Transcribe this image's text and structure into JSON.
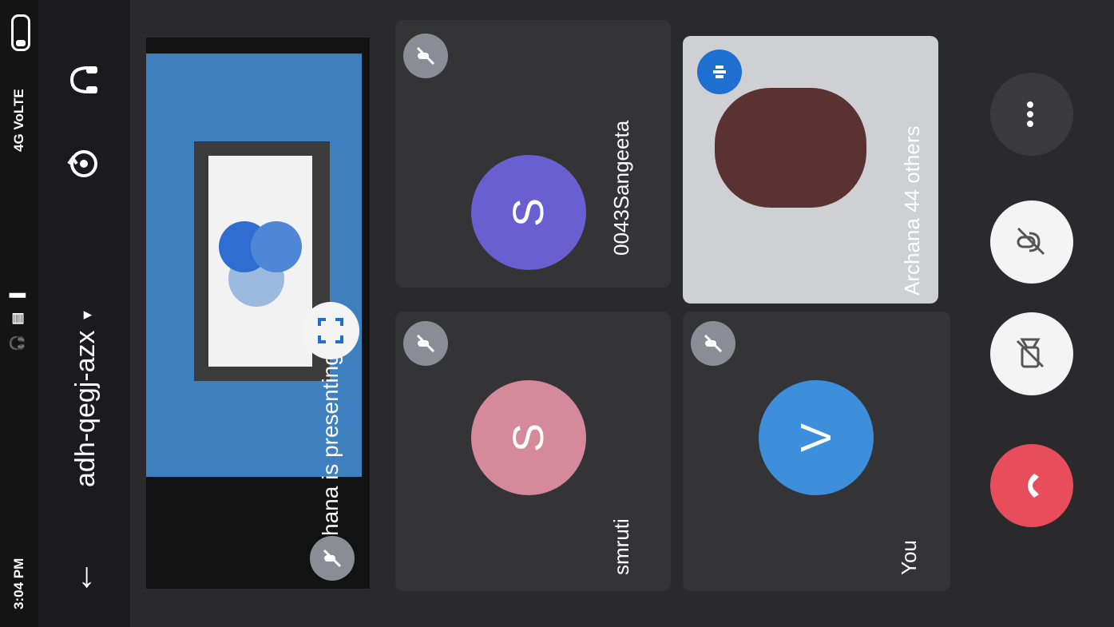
{
  "status_bar": {
    "time": "3:04 PM",
    "signal_text": "4G VoLTE",
    "data_label": "4G"
  },
  "header": {
    "meeting_code": "adh-qegj-azx"
  },
  "presentation": {
    "presenter_label": "Archana is presenting"
  },
  "participants": [
    {
      "name": "0043Sangeeta",
      "initial": "S",
      "avatar_color": "#6a5fd0"
    },
    {
      "name": "smruti",
      "initial": "S",
      "avatar_color": "#d58a9c"
    },
    {
      "name": "You",
      "initial": "V",
      "avatar_color": "#3d8fdc"
    }
  ],
  "video_tile": {
    "name": "Archana",
    "others_label": "44 others"
  },
  "colors": {
    "end_call": "#e84d5c",
    "mute_badge": "#8a8d96",
    "accent": "#1f6fd1"
  },
  "controls": {
    "icons": [
      "mic-off-icon",
      "camera-off-icon",
      "end-call-icon",
      "more-icon"
    ]
  }
}
